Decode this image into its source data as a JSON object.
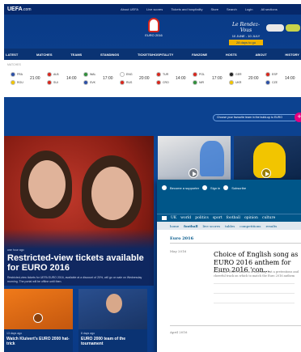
{
  "uefa": {
    "logo": "UEFA",
    "logo_suffix": ".com",
    "top_links": [
      "About UEFA",
      "Live scores",
      "Tickets and hospitality",
      "Store",
      "Search",
      "Login",
      "All sections"
    ],
    "emblem_text": "EURO 2016",
    "countdown_script": "Le Rendez-Vous",
    "countdown_dates": "10 JUNE - 10 JULY",
    "countdown_days": "28 days to go",
    "nav": [
      "LATEST",
      "MATCHES",
      "TEAMS",
      "STANDINGS",
      "TICKETS/HOSPITALITY",
      "FANZONE",
      "HOSTS",
      "ABOUT",
      "HISTORY"
    ],
    "matchbar_label": "MATCHES",
    "matches": [
      {
        "team1": "FRA",
        "team2": "ROU",
        "time": "21:00",
        "c1": "#2b4fa6",
        "c2": "#f2c500"
      },
      {
        "team1": "ALB",
        "team2": "SUI",
        "time": "14:00",
        "c1": "#d9261c",
        "c2": "#d9261c"
      },
      {
        "team1": "WAL",
        "team2": "SVK",
        "time": "17:00",
        "c1": "#2f8f3a",
        "c2": "#2b4fa6"
      },
      {
        "team1": "ENG",
        "team2": "RUS",
        "time": "20:00",
        "c1": "#ffffff",
        "c2": "#d9261c"
      },
      {
        "team1": "TUR",
        "team2": "CRO",
        "time": "14:00",
        "c1": "#d9261c",
        "c2": "#d9261c"
      },
      {
        "team1": "POL",
        "team2": "NIR",
        "time": "17:00",
        "c1": "#d9261c",
        "c2": "#2f8f3a"
      },
      {
        "team1": "GER",
        "team2": "UKR",
        "time": "20:00",
        "c1": "#222222",
        "c2": "#f2c500"
      },
      {
        "team1": "ESP",
        "team2": "CZE",
        "time": "14:00",
        "c1": "#d9261c",
        "c2": "#2b4fa6"
      }
    ],
    "choose_team": "Choose your favourite team in the build-up to EURO",
    "main_story": {
      "time": "one hour ago",
      "title": "Restricted-view tickets available for EURO 2016",
      "desc": "Restricted-view tickets for UEFA EURO 2016, available at a discount of 20%, will go on sale on Wednesday morning. The portal will be offline until then."
    },
    "small_cards": [
      {
        "time": "13 days ago",
        "title": "Watch Kluivert's EURO 2000 hat-trick"
      },
      {
        "time": "8 days ago",
        "title": "EURO 2000 team of the tournament"
      }
    ]
  },
  "guardian": {
    "top_links": [
      "Become a supporter",
      "Sign in",
      "Subscribe"
    ],
    "nav": [
      "UK",
      "world",
      "politics",
      "sport",
      "football",
      "opinion",
      "culture"
    ],
    "sub_nav": [
      "home",
      "football",
      "live scores",
      "tables",
      "competitions",
      "results"
    ],
    "section": "Euro 2016",
    "date1": "May 2016",
    "date2": "April 2016",
    "headline": "Choice of English song as EURO 2016 anthem for Euro 2016 'con...",
    "stand": "Irish Man Won'It Anthem is anything but a pretentious and cheerful track on which to match the Euro 2016 anthem"
  }
}
